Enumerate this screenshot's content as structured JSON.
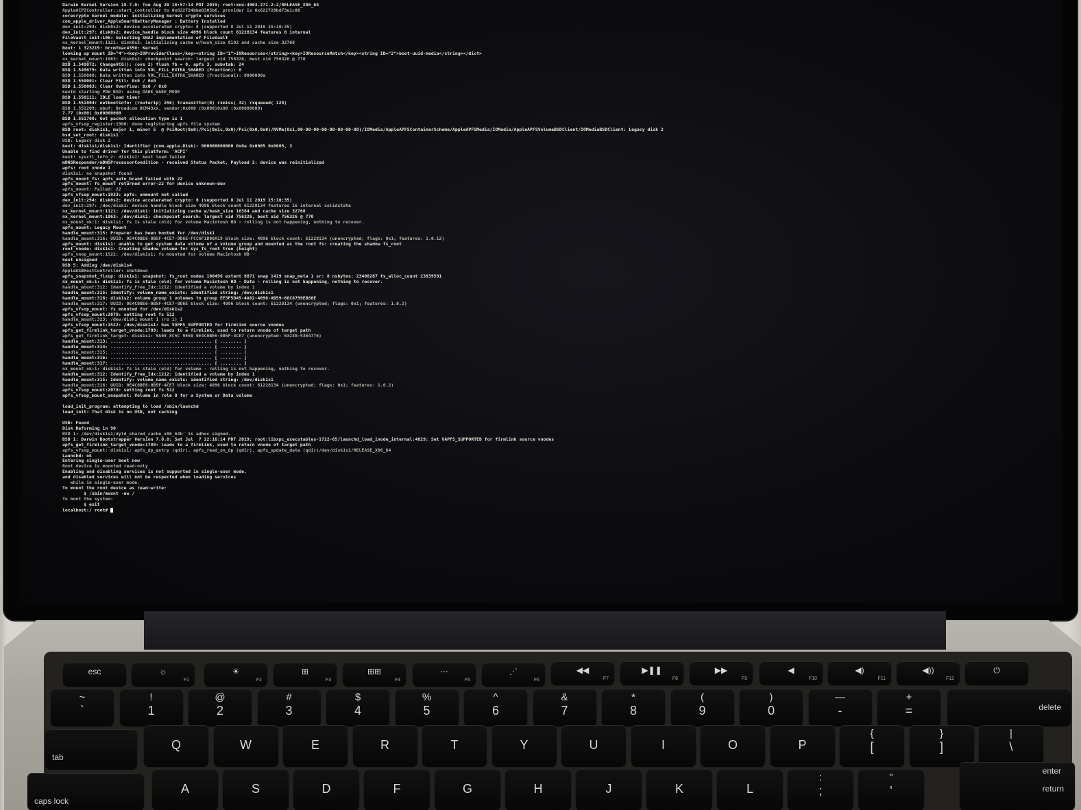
{
  "terminal": {
    "lines": [
      "Darwin Kernel Version 18.7.0: Tue Aug 20 16:57:14 PDT 2019; root:xnu-4903.271.2~2/RELEASE_X86_64",
      "AppleACPIController::start_controller to 0x622724bbe0305b6, provider is 0x622720bd73e1c00",
      "corecrypto kernel module: initializing kernel crypto services",
      "com_apple_driver_AppleSmartBatteryManager : Battery Installed",
      "dev_init:294: disk0s2: device accelerated crypto: 8 (supported 8 Jul 11 2019 15:10:35)",
      "dev_init:297: disk0s2: device_handle block size 4096 block count 61228134 features 0 internal",
      "FileVault_init:106: Selecting SHA2 implementation of FileVault",
      "nx_kernel_mount:1121: disk0s2: initializing cache w/hash_size 8192 and cache size 32768",
      "Boot: 1 323219: brcmfmac4350: Kernel",
      "looking up mount ID=\"4\"><key>IOProviderClass</key><string ID=\"1\">IOResources</string><key>IOResourceMatch</key><string ID=\"2\">boot-uuid-media</string></dict>",
      "nx_kernel_mount:1063: disk0s2: checkpoint search: largest xid 756326, best xid 756326 @ 770",
      "BSD 1.549872: ChangeVCG(): (ovs 2) flush fb = 0, apfs 3, subvtab: 24",
      "BSD 1.549879: Data written into VOL_FILL_EXTRA_SHARED (Fraction): 0",
      "BSD 1.550000: Data written into VOL_FILL_EXTRA_SHARED (Fractional): 0000000a",
      "BSD 1.550001: Clear Fill: 0x0 / 0x0",
      "BSD 1.550003: Clear Overflow: 0x0 / 0x0",
      "kextd starting PDW_BSD: using DARK_WAKE_MODE",
      "BSD 1.550111: IDLE load timer",
      "BSD 1.551004: netbootinfo: (routerip) 256) transmitter(0) rxmiss( 32) rxqueued( 128)",
      "BSD 1.551209: mbuf: Broadcom BCM43xx, vendor:0x000 (0x000)0x00 (0x00000000)",
      "7.77 (0x00) 0x00000000",
      "BSD 1.551700: Got packet allocation type is 1",
      "apfs_vfsop_register:1906: done registering apfs file system",
      "BSD root: disk1s1, major 1, minor 5  @ PciRoot(0x0)/Pci(0x1c,0x0)/Pci(0x0,0x0)/NVMe(0x1,00-00-00-00-00-00-00-00)/IOMedia/AppleAPFSContainerScheme/AppleAPFSMedia/IOMedia/AppleAPFSVolumeBSDClient/IOMediaBSDClient: Legacy disk 2",
      "bsd_set_root: disk1s1",
      "USB: Legacy disk 2",
      "kext: disk1s1/disk1s1: Identifier (com.apple.Disk): 000000000000 0x0a 0x0005 0x0005, 3",
      "Unable to find driver for this platform: 'ACPI'",
      "kext: sysctl_info_2: disk1s1: kext load failed",
      "mDNSResponder/mDNSProcessorCondition - received Status Packet, Payload 2: device was reinitialized",
      "apfs: root vnode 1",
      "disk1s1: no snapshot found",
      "apfs_mount_fs: apfs_auto_brand failed with 22",
      "apfs_mount: fs_mount returned error-22 for device unknown-dev",
      "apfs_mount: Failed: 22",
      "apfs_vfsop_mount:1933: apfs: unmount not called",
      "dev_init:294: disk0s2: device accelerated crypto: 8 (supported 8 Jul 11 2019 15:10:35)",
      "dev_init:297: /dev/disk1: device handle block size 4096 block count 61228134 features 16 internal solidstate",
      "nx_kernel_mount:1121: /dev/disk1: initializing cache w/hash_size 16384 and cache size 32768",
      "nx_kernel_mount:1063: /dev/disk1: checkpoint search: largest xid 756326, best xid 756326 @ 770",
      "nx_mount_ok:1: disk1s1: fs is stale (old) for volume Macintosh HD - rolling is not happening, nothing to recover.",
      "apfs_mount: Legacy Mount",
      "handle_mount:315: Preparer has been booted for /dev/disk1",
      "handle_mount:316: UUID: 0E4C0BE6-0B5F-4CE7-9D6E-FCC6F1D98A19 block size: 4096 block count: 61228134 (unencrypted; flags: 0x1; features: 1.0.12)",
      "apfs_mount: disk1s1: unable to get system data volume of a volume group and mounted as the root fs: creating the shadow fs_root",
      "root_vnode: disk1s1: Creating shadow volume for sys_fs_root tree (height)",
      "apfs_vnop_mount:1522: /dev/disk1s1: fs mounted for volume Macintosh HD",
      "kext unsigned",
      "BSD 5: Adding /dev/disk1s4",
      "AppleUSBHostController: shutdown",
      "apfs_snapshot_fixup: disk1s1: snapshot: fs_root nodes 100496 extent 8871 snap 1419 snap_meta 1 sr: 8 nsbytes: 23408287 fs_alloc_count 23839591",
      "nx_mount_ok:1: disk1s1: fs is stale (old) for volume Macintosh HD - Data - rolling is not happening, nothing to recover.",
      "handle_mount:312: Identify_Free_Idx:1212: identified a volume by index 1",
      "handle_mount:315: Identify: volume_name_exists: identified string: /dev/disk1s1",
      "handle_mount:316: disk1s2: volume group 1 volumes to group EF3F5D45-4A82-4096-AB59-66C6799EB88E",
      "handle_mount:317: UUID: 0E4C0BE6-0B5F-4CE7-9D6E block size: 4096 block count: 61228134 (unencrypted; flags: 0x1; features: 1.0.2)",
      "apfs_vfsop_mount: fs mounted for /dev/disk1s2",
      "apfs_vfsop_mount:2078: setting root fs 512",
      "handle_mount:323: /dev/disk1 mount 1 (ro 1) 1",
      "apfs_vfsop_mount:1522: /dev/disk1s1: has VAPFS_SUPPORTED for firmlink source vnodes",
      "apfs_get_firmlink_target_vnode:1789: leads to a firmlink, used to return vnode of target path",
      "apfs_get_firmlink_target: disk1s1: 9A08 8C5C 9E60 0E4C0BE6-0B5F-4CE7 (unencrypted: 63230-5364776)",
      "handle_mount:313: ...................................... [ ........ ]",
      "handle_mount:314: ...................................... [ ........ ]",
      "handle_mount:315: ...................................... [ ........ ]",
      "handle_mount:316: ...................................... [ ........ ]",
      "handle_mount:317: ...................................... [ ........ ]",
      "nx_mount_ok:1: disk1s1: fs is stale (old) for volume - rolling is not happening, nothing to recover.",
      "handle_mount:312: Identify_Free_Idx:1212: identified a volume by index 1",
      "handle_mount:315: Identify: volume_name_exists: identified string: /dev/disk1s1",
      "handle_mount:316: UUID: 0E4C0BE6-0B5F-4CE7 block size: 4096 block count: 61228134 (unencrypted; flags: 0x1; features: 1.0.2)",
      "apfs_vfsop_mount:2078: setting root fs 512",
      "apfs_vfsop_mount_snapshot: Volume in role 0 for a System or Data volume",
      "",
      "load_init_program: attempting to load /sbin/launchd",
      "load_init: That disk is no USB, not caching",
      "",
      "USB: Found",
      "Disk Reforming in 90",
      "BSD 1: /dev/disk1s1/dyld_shared_cache_x86_64h' is adhoc signed.",
      "BSD 1: Darwin Bootstrapper Version 7.0.0: Sat Jul  7 22:16:14 PDT 2019; root:libxpc_executables-1722-65/launchd_load_inode_internal:4829: Set VAPFS_SUPPORTED for firmlink source vnodes",
      "apfs_get_firmlink_target_vnode:1789: leads to a firmlink, used to return vnode of target path",
      "apfs_vfsop_mount: disk1s1: apfs_dp_entry (qdir), apfs_read_on_dp (qdir), apfs_update_data (qdir)/dev/disk1s1/RELEASE_X86_64",
      "Launchd: ok",
      "Entering single-user boot now",
      "Root device is mounted read-only",
      "Enabling and disabling services is not supported in single-user mode,",
      "and disabled services will not be respected when loading services",
      "   while in single-user mode.",
      "To mount the root device as read-write:",
      "        $ /sbin/mount -uw /",
      "To boot the system:",
      "        $ exit",
      "localhost:/ root# "
    ]
  },
  "function_row": [
    {
      "label": "esc",
      "sub": ""
    },
    {
      "label": "☼",
      "sub": "F1"
    },
    {
      "label": "☀",
      "sub": "F2"
    },
    {
      "label": "⊞",
      "sub": "F3"
    },
    {
      "label": "⊞⊞",
      "sub": "F4"
    },
    {
      "label": "⋯",
      "sub": "F5"
    },
    {
      "label": "⋰",
      "sub": "F6"
    },
    {
      "label": "◀◀",
      "sub": "F7"
    },
    {
      "label": "▶❚❚",
      "sub": "F8"
    },
    {
      "label": "▶▶",
      "sub": "F9"
    },
    {
      "label": "◀",
      "sub": "F10"
    },
    {
      "label": "◀)",
      "sub": "F11"
    },
    {
      "label": "◀))",
      "sub": "F12"
    },
    {
      "label": "⏻",
      "sub": ""
    }
  ],
  "number_row": [
    {
      "top": "~",
      "main": "`"
    },
    {
      "top": "!",
      "main": "1"
    },
    {
      "top": "@",
      "main": "2"
    },
    {
      "top": "#",
      "main": "3"
    },
    {
      "top": "$",
      "main": "4"
    },
    {
      "top": "%",
      "main": "5"
    },
    {
      "top": "^",
      "main": "6"
    },
    {
      "top": "&",
      "main": "7"
    },
    {
      "top": "*",
      "main": "8"
    },
    {
      "top": "(",
      "main": "9"
    },
    {
      "top": ")",
      "main": "0"
    },
    {
      "top": "—",
      "main": "-"
    },
    {
      "top": "+",
      "main": "="
    }
  ],
  "delete_label": "delete",
  "tab_label": "tab",
  "qwerty_row": [
    {
      "top": "",
      "main": "Q"
    },
    {
      "top": "",
      "main": "W"
    },
    {
      "top": "",
      "main": "E"
    },
    {
      "top": "",
      "main": "R"
    },
    {
      "top": "",
      "main": "T"
    },
    {
      "top": "",
      "main": "Y"
    },
    {
      "top": "",
      "main": "U"
    },
    {
      "top": "",
      "main": "I"
    },
    {
      "top": "",
      "main": "O"
    },
    {
      "top": "",
      "main": "P"
    },
    {
      "top": "{",
      "main": "["
    },
    {
      "top": "}",
      "main": "]"
    },
    {
      "top": "|",
      "main": "\\"
    }
  ],
  "caps_label": "caps lock",
  "home_row": [
    {
      "top": "",
      "main": "A"
    },
    {
      "top": "",
      "main": "S"
    },
    {
      "top": "",
      "main": "D"
    },
    {
      "top": "",
      "main": "F"
    },
    {
      "top": "",
      "main": "G"
    },
    {
      "top": "",
      "main": "H"
    },
    {
      "top": "",
      "main": "J"
    },
    {
      "top": "",
      "main": "K"
    },
    {
      "top": "",
      "main": "L"
    },
    {
      "top": ":",
      "main": ";"
    },
    {
      "top": "\"",
      "main": "'"
    }
  ],
  "enter_label": "enter",
  "return_label": "return"
}
